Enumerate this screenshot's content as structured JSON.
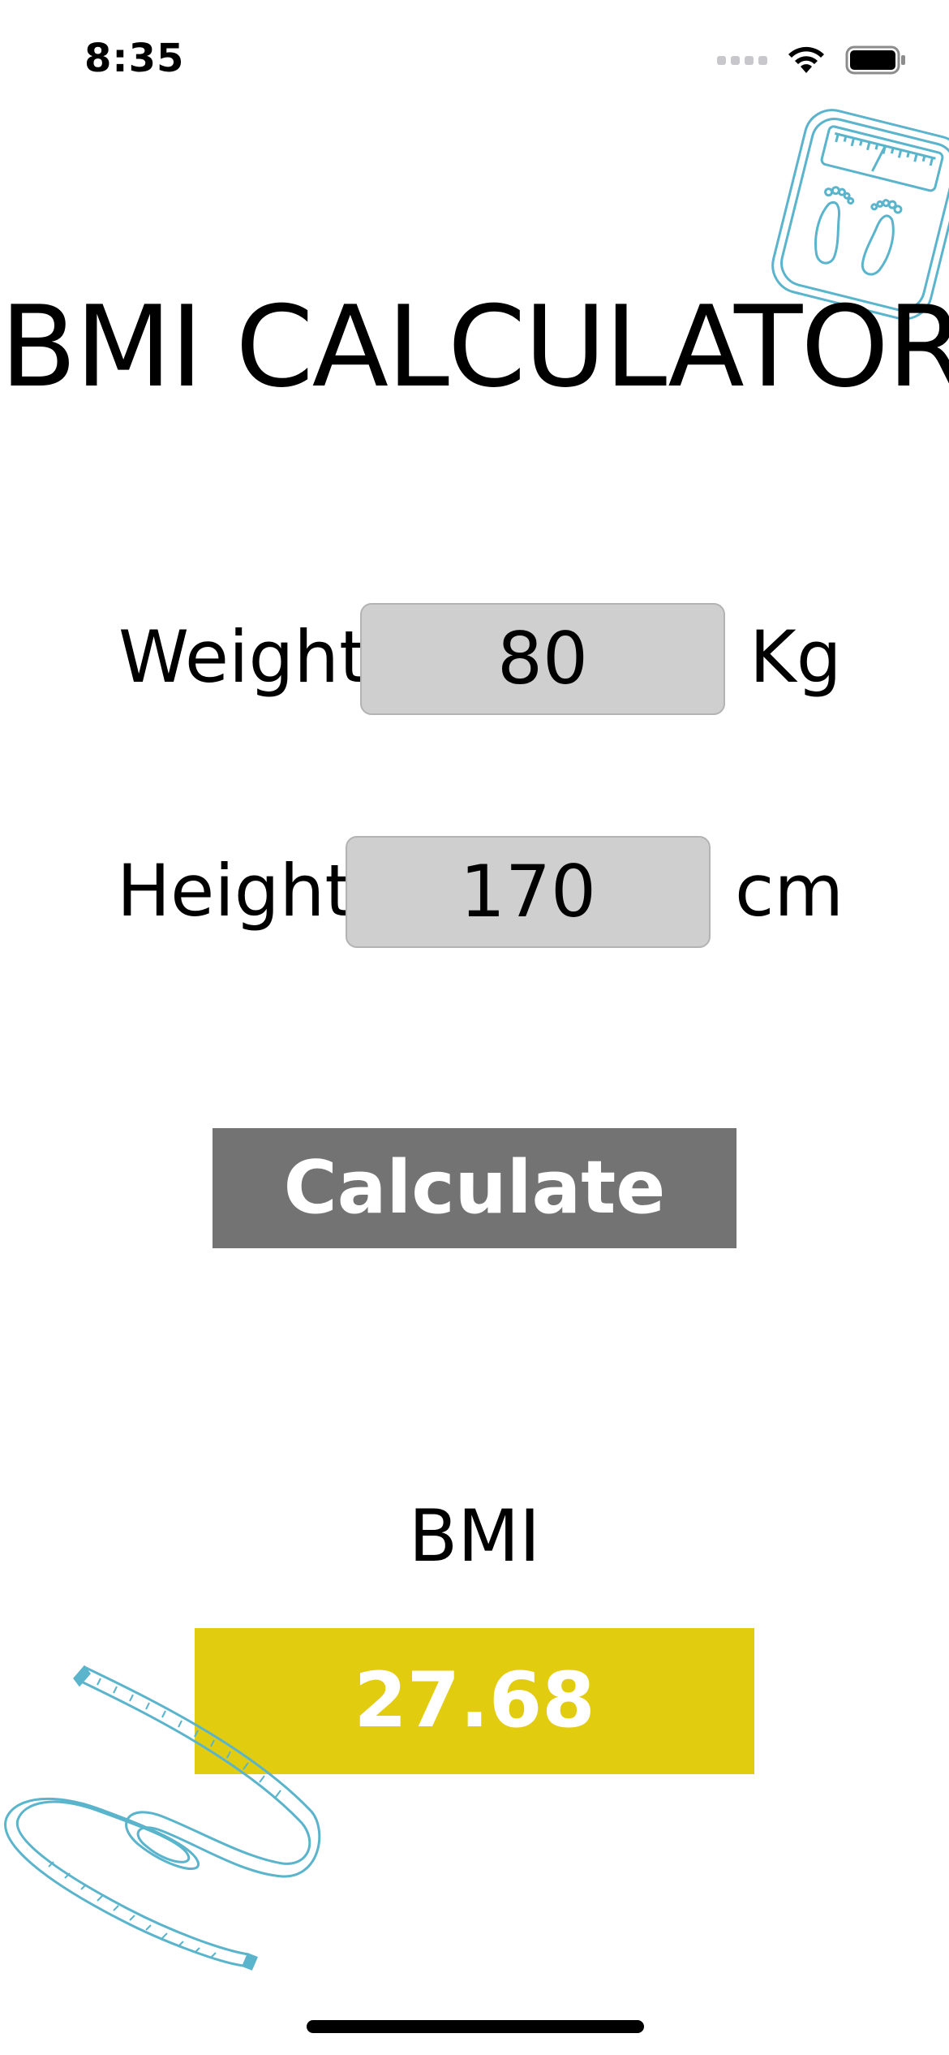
{
  "status_bar": {
    "time": "8:35"
  },
  "title": "BMI CALCULATOR",
  "weight": {
    "label": "Weight",
    "value": "80",
    "unit": "Kg"
  },
  "height": {
    "label": "Height",
    "value": "170",
    "unit": "cm"
  },
  "calculate_label": "Calculate",
  "result": {
    "label": "BMI",
    "value": "27.68"
  },
  "colors": {
    "button": "#737373",
    "result_box": "#e2cc0f",
    "input_bg": "#cfcfcf",
    "illustration": "#5ab4cc"
  },
  "icons": [
    "wifi-icon",
    "battery-icon",
    "bathroom-scale-icon",
    "measuring-tape-icon"
  ]
}
